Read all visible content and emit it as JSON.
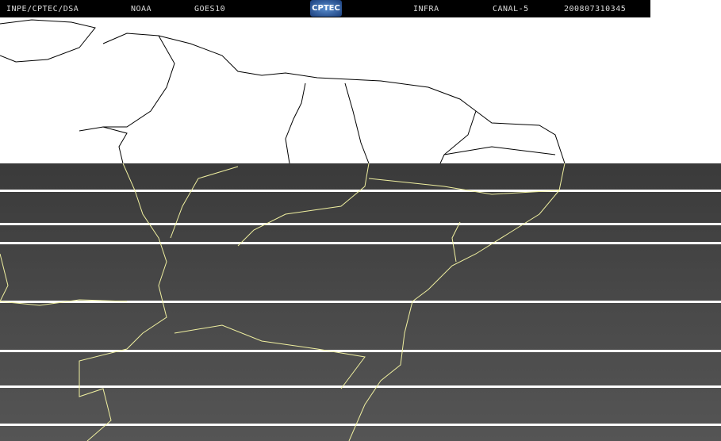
{
  "header": {
    "agency": "INPE/CPTEC/DSA",
    "operator": "NOAA",
    "satellite": "GOES10",
    "logo_text": "CPTEC",
    "product": "INFRA",
    "channel": "CANAL-5",
    "timestamp": "200807310345"
  },
  "colors": {
    "coastline_ir": "#f0f0a0",
    "coastline_white": "#000000",
    "ir_background": "#444444"
  }
}
